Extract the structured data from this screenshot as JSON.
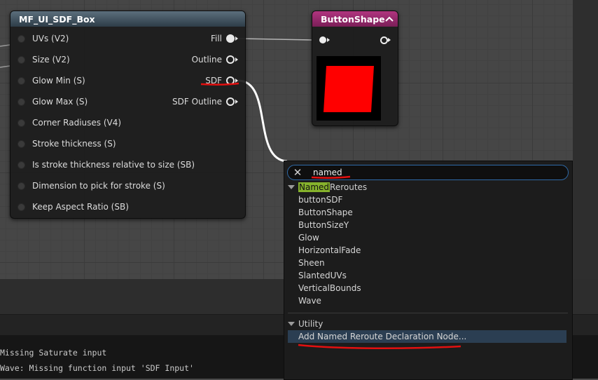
{
  "node_sdf_box": {
    "title": "MF_UI_SDF_Box",
    "inputs": [
      "UVs (V2)",
      "Size (V2)",
      "Glow Min (S)",
      "Glow Max (S)",
      "Corner Radiuses (V4)",
      "Stroke thickness (S)",
      "Is stroke thickness relative to size (SB)",
      "Dimension to pick for stroke (S)",
      "Keep Aspect Ratio (SB)"
    ],
    "outputs": [
      "Fill",
      "Outline",
      "SDF",
      "SDF Outline"
    ]
  },
  "node_button_shape": {
    "title": "ButtonShape",
    "preview_color": "#ff0000"
  },
  "search": {
    "query": "named",
    "clear_icon": "close-icon"
  },
  "categories": {
    "named_reroutes": {
      "highlight": "Named",
      "rest": " Reroutes"
    },
    "utility": {
      "label": "Utility"
    }
  },
  "reroute_items": [
    "buttonSDF",
    "ButtonShape",
    "ButtonSizeY",
    "Glow",
    "HorizontalFade",
    "Sheen",
    "SlantedUVs",
    "VerticalBounds",
    "Wave"
  ],
  "utility_items": [
    "Add Named Reroute Declaration Node..."
  ],
  "log": {
    "line1": " Missing Saturate input",
    "line2": "Wave: Missing function input 'SDF Input'"
  },
  "colors": {
    "annotation_red": "#e31010",
    "search_highlight": "#86b22c",
    "selection": "#2b3e52"
  }
}
